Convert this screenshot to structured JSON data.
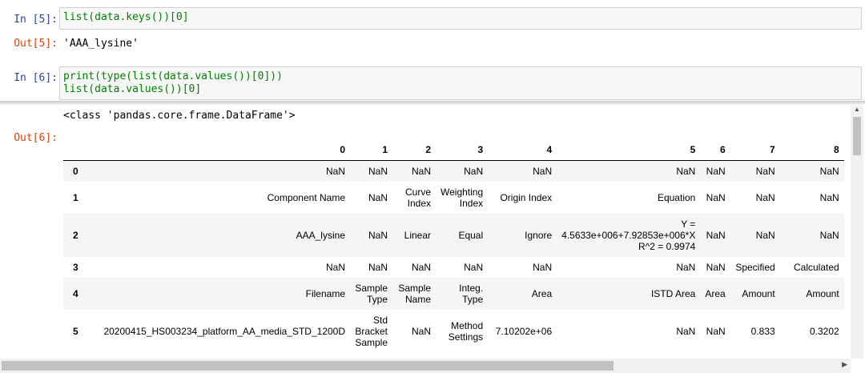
{
  "cells": {
    "in5_prompt": "In  [5]:",
    "in5_code": "list(data.keys())[0]",
    "out5_prompt": "Out[5]:",
    "out5_value": "'AAA_lysine'",
    "in6_prompt": "In  [6]:",
    "in6_code_line1": "print(type(list(data.values())[0]))",
    "in6_code_line2": "list(data.values())[0]",
    "out6_prompt": "Out[6]:",
    "out6_stdout": "<class 'pandas.core.frame.DataFrame'>"
  },
  "dataframe": {
    "columns": [
      "",
      "0",
      "1",
      "2",
      "3",
      "4",
      "5",
      "6",
      "7",
      "8"
    ],
    "rows": [
      {
        "index": "0",
        "cells": [
          "NaN",
          "NaN",
          "NaN",
          "NaN",
          "NaN",
          "NaN",
          "NaN",
          "NaN",
          "NaN"
        ]
      },
      {
        "index": "1",
        "cells": [
          "Component Name",
          "NaN",
          "Curve\nIndex",
          "Weighting\nIndex",
          "Origin Index",
          "Equation",
          "NaN",
          "NaN",
          "NaN"
        ]
      },
      {
        "index": "2",
        "cells": [
          "AAA_lysine",
          "NaN",
          "Linear",
          "Equal",
          "Ignore",
          "Y =\n4.5633e+006+7.92853e+006*X\nR^2 = 0.9974",
          "NaN",
          "NaN",
          "NaN"
        ]
      },
      {
        "index": "3",
        "cells": [
          "NaN",
          "NaN",
          "NaN",
          "NaN",
          "NaN",
          "NaN",
          "NaN",
          "Specified",
          "Calculated"
        ]
      },
      {
        "index": "4",
        "cells": [
          "Filename",
          "Sample\nType",
          "Sample\nName",
          "Integ.\nType",
          "Area",
          "ISTD Area",
          "Area",
          "Amount",
          "Amount"
        ]
      },
      {
        "index": "5",
        "cells": [
          "20200415_HS003234_platform_AA_media_STD_1200D",
          "Std\nBracket\nSample",
          "NaN",
          "Method\nSettings",
          "7.10202e+06",
          "NaN",
          "NaN",
          "0.833",
          "0.3202"
        ]
      }
    ],
    "row_heights": [
      26,
      40,
      54,
      26,
      40,
      54
    ]
  },
  "colors": {
    "in_prompt": "#303f9f",
    "out_prompt": "#d84315",
    "code_keyword": "#008000",
    "cell_bg": "#f7f7f7"
  },
  "icons": [
    "scroll-up-arrow-icon",
    "scroll-right-arrow-icon"
  ]
}
